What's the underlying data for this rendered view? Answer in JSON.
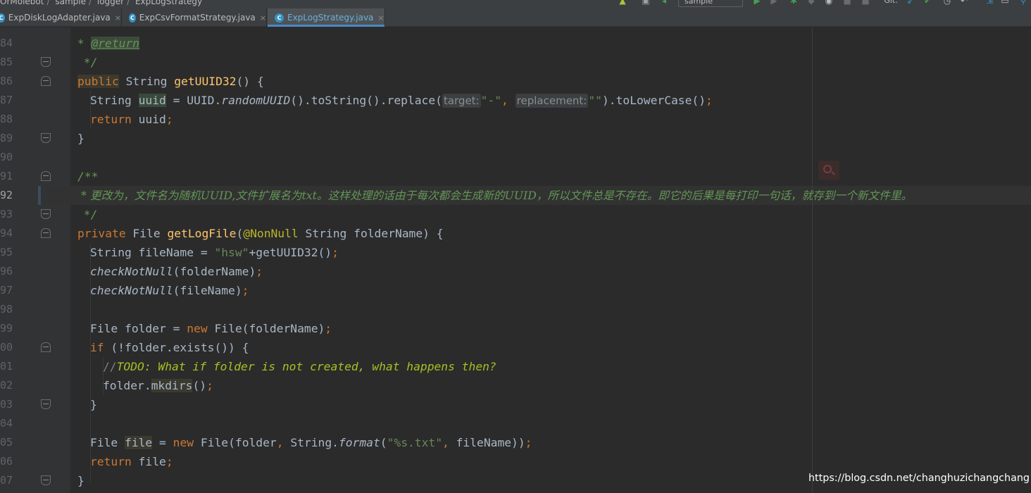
{
  "breadcrumb": [
    "OrMoiebot",
    "sample",
    "logger",
    "ExpLogStrategy"
  ],
  "run_config": "sample",
  "toolbar_vcs_label": "Git:",
  "tabs": [
    {
      "label": "ExpDiskLogAdapter.java",
      "close": "×"
    },
    {
      "label": "ExpCsvFormatStrategy.java",
      "close": "×"
    },
    {
      "label": "ExpLogStrategy.java",
      "close": "×",
      "active": true
    }
  ],
  "editor": {
    "current_line": 92,
    "line_numbers": [
      "84",
      "85",
      "86",
      "87",
      "88",
      "89",
      "90",
      "91",
      "92",
      "93",
      "94",
      "95",
      "96",
      "97",
      "98",
      "99",
      "00",
      "01",
      "02",
      "03",
      "04",
      "05",
      "06",
      "07"
    ],
    "code": {
      "l84": {
        "star": " * ",
        "tag": "@return"
      },
      "l85": " */",
      "l86": {
        "kw": "public",
        "rest": " String ",
        "fn": "getUUID32",
        "end": "() {"
      },
      "l87": {
        "a": "String ",
        "var": "uuid",
        "b": " = UUID.",
        "m": "randomUUID",
        "c": "().toString().replace(",
        "hint1": "target:",
        "s1": "\"-\"",
        "comma": ", ",
        "hint2": "replacement:",
        "s2": "\"\"",
        "d": ").toLowerCase()",
        "semi": ";"
      },
      "l88": {
        "kw": "return",
        "rest": " uuid",
        "semi": ";"
      },
      "l89": "}",
      "l91": "/**",
      "l92": " * 更改为，文件名为随机UUID,文件扩展名为txt。这样处理的话由于每次都会生成新的UUID，所以文件总是不存在。即它的后果是每打印一句话，就存到一个新文件里。",
      "l93": " */",
      "l94": {
        "kw": "private",
        "a": " File ",
        "fn": "getLogFile",
        "b": "(",
        "ann": "@NonNull",
        "c": " String folderName) {"
      },
      "l95": {
        "a": "String fileName = ",
        "s": "\"hsw\"",
        "b": "+getUUID32()",
        "semi": ";"
      },
      "l96": {
        "m": "checkNotNull",
        "a": "(folderName)",
        "semi": ";"
      },
      "l97": {
        "m": "checkNotNull",
        "a": "(fileName)",
        "semi": ";"
      },
      "l99": {
        "a": "File folder = ",
        "kw": "new",
        "b": " File(folderName)",
        "semi": ";"
      },
      "l100": {
        "kw": "if",
        "a": " (!folder.exists()) {"
      },
      "l101": {
        "slashes": "//",
        "todo": "TODO: What if folder is not created, what happens then?"
      },
      "l102": {
        "a": "folder.",
        "m": "mkdirs",
        "b": "()",
        "semi": ";"
      },
      "l103": "}",
      "l105": {
        "a": "File ",
        "var": "file",
        "b": " = ",
        "kw": "new",
        "c": " File(folder",
        "comma": ",",
        "d": " String.",
        "m": "format",
        "e": "(",
        "s": "\"%s.txt\"",
        "comma2": ",",
        "f": " fileName))",
        "semi": ";"
      },
      "l106": {
        "kw": "return",
        "rest": " file",
        "semi": ";"
      },
      "l107": "}"
    }
  },
  "watermark": "https://blog.csdn.net/changhuzichangchang",
  "colors": {
    "background": "#2b2b2b",
    "gutter": "#313335",
    "keyword": "#cc7832",
    "method": "#ffc66d",
    "string": "#6a8759",
    "comment": "#629755",
    "annotation": "#bbb529",
    "active_tab_accent": "#4a88c7"
  }
}
